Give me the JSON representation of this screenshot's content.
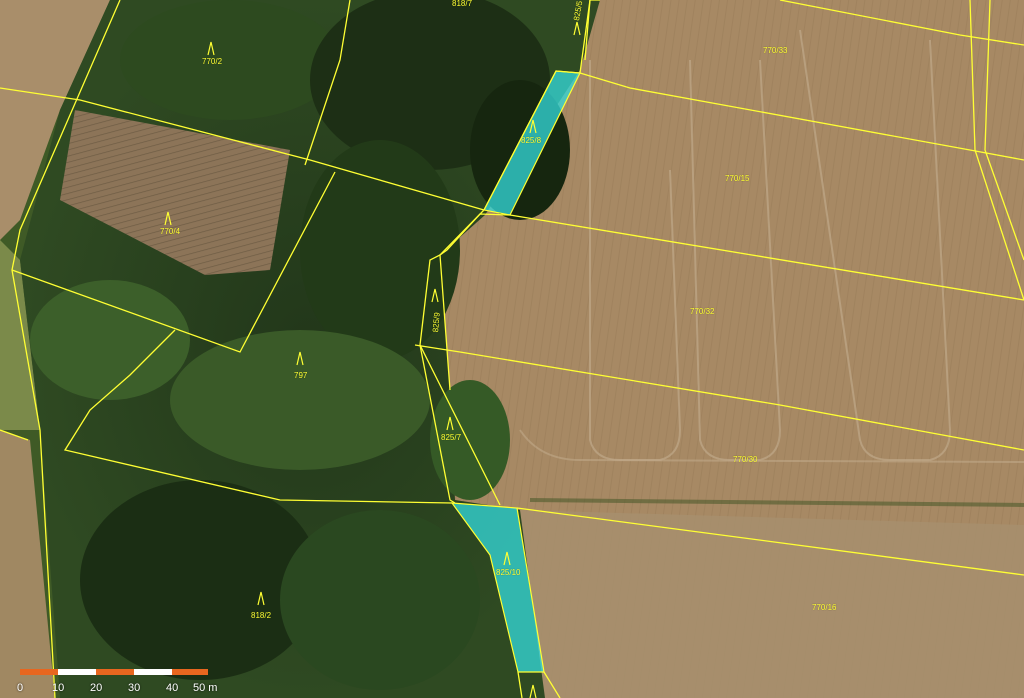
{
  "map": {
    "colors": {
      "parcel_boundary": "#ffff33",
      "highlighted_parcel": "#33d6d6",
      "scale_bar_orange": "#e8661f",
      "scale_bar_white": "#ffffff"
    },
    "parcels": [
      {
        "id": "p-770-2",
        "label": "770/2"
      },
      {
        "id": "p-770-4",
        "label": "770/4"
      },
      {
        "id": "p-797",
        "label": "797"
      },
      {
        "id": "p-818-2",
        "label": "818/2"
      },
      {
        "id": "p-818-7",
        "label": "818/7"
      },
      {
        "id": "p-825-5",
        "label": "825/5"
      },
      {
        "id": "p-825-8",
        "label": "825/8"
      },
      {
        "id": "p-825-9",
        "label": "825/9"
      },
      {
        "id": "p-825-7",
        "label": "825/7"
      },
      {
        "id": "p-825-10",
        "label": "825/10"
      },
      {
        "id": "p-770-33",
        "label": "770/33"
      },
      {
        "id": "p-770-15",
        "label": "770/15"
      },
      {
        "id": "p-770-32",
        "label": "770/32"
      },
      {
        "id": "p-770-30",
        "label": "770/30"
      },
      {
        "id": "p-770-16",
        "label": "770/16"
      }
    ],
    "scale_bar": {
      "ticks": [
        "0",
        "10",
        "20",
        "30",
        "40",
        "50 m"
      ]
    }
  }
}
